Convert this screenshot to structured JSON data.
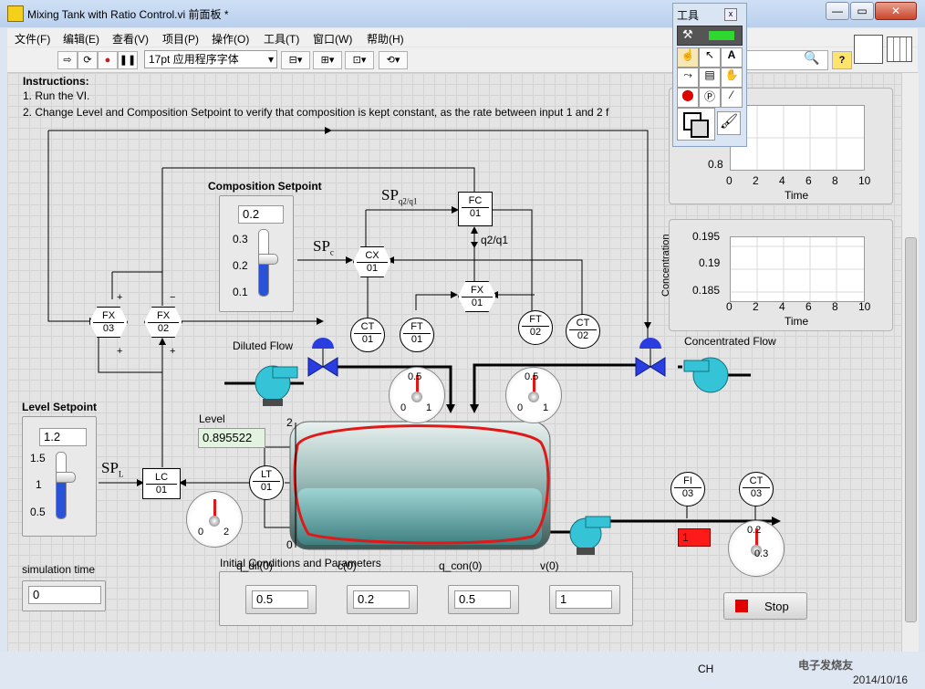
{
  "window": {
    "title": "Mixing Tank with Ratio Control.vi 前面板 *",
    "min_glyph": "—",
    "max_glyph": "▭",
    "close_glyph": "✕"
  },
  "menu": [
    "文件(F)",
    "编辑(E)",
    "查看(V)",
    "项目(P)",
    "操作(O)",
    "工具(T)",
    "窗口(W)",
    "帮助(H)"
  ],
  "toolbar": {
    "font": "17pt 应用程序字体",
    "help": "?"
  },
  "tools_palette": {
    "title": "工具",
    "close": "x"
  },
  "instructions": {
    "heading": "Instructions:",
    "line1": "1. Run the VI.",
    "line2": "2. Change Level and Composition Setpoint to verify that composition is kept constant, as the rate between input 1 and 2 f"
  },
  "composition_setpoint": {
    "label": "Composition Setpoint",
    "value": "0.2",
    "ticks": [
      "0.3",
      "0.2",
      "0.1"
    ],
    "fill": 0.55
  },
  "level_setpoint": {
    "label": "Level Setpoint",
    "value": "1.2",
    "ticks": [
      "1.5",
      "1",
      "0.5"
    ],
    "fill": 0.62
  },
  "level": {
    "label": "Level",
    "value": "0.895522",
    "scale_top": "2",
    "scale_bottom": "0"
  },
  "flows": {
    "diluted": "Diluted Flow",
    "concentrated": "Concentrated Flow"
  },
  "sp": {
    "sp": "SP",
    "q2q1": "q2/q1",
    "c": "c",
    "l": "L",
    "q2q1_line": "q2/q1"
  },
  "instruments": {
    "fc": [
      "FC",
      "01"
    ],
    "cx": [
      "CX",
      "01"
    ],
    "fx1": [
      "FX",
      "01"
    ],
    "fx2": [
      "FX",
      "02"
    ],
    "fx3": [
      "FX",
      "03"
    ],
    "ct1": [
      "CT",
      "01"
    ],
    "ft1": [
      "FT",
      "01"
    ],
    "ft2": [
      "FT",
      "02"
    ],
    "ct2": [
      "CT",
      "02"
    ],
    "lc": [
      "LC",
      "01"
    ],
    "lt": [
      "LT",
      "01"
    ],
    "fi3": [
      "FI",
      "03"
    ],
    "ct3": [
      "CT",
      "03"
    ]
  },
  "gauges": {
    "ft1": {
      "top": "0.5",
      "left": "0",
      "right": "1"
    },
    "ft2": {
      "top": "0.5",
      "left": "0",
      "right": "1"
    },
    "lc": {
      "left": "0",
      "right": "2"
    },
    "ct3": {
      "top": "0.2",
      "right": "0.3"
    }
  },
  "fi03_value": "1",
  "sim_time": {
    "label": "simulation time",
    "value": "0"
  },
  "initial": {
    "label": "Initial Conditions and Parameters",
    "params": [
      {
        "name": "q_dil(0)",
        "value": "0.5"
      },
      {
        "name": "c(0)",
        "value": "0.2"
      },
      {
        "name": "q_con(0)",
        "value": "0.5"
      },
      {
        "name": "v(0)",
        "value": "1"
      }
    ]
  },
  "stop": {
    "label": "Stop"
  },
  "graph1": {
    "y_tick": "0.8",
    "x_ticks": [
      "0",
      "2",
      "4",
      "6",
      "8",
      "10"
    ],
    "xlabel": "Time"
  },
  "graph2": {
    "ylabel": "Concentration",
    "y_ticks": [
      "0.195",
      "0.19",
      "0.185"
    ],
    "x_ticks": [
      "0",
      "2",
      "4",
      "6",
      "8",
      "10"
    ],
    "xlabel": "Time"
  },
  "taskbar": {
    "ch": "CH",
    "date": "2014/10/16",
    "watermark": "电子发烧友"
  },
  "colors": {
    "annotation": "#e01818",
    "pump": "#35c3d8",
    "valve": "#2a3de0",
    "slider": "#2a52d8"
  }
}
